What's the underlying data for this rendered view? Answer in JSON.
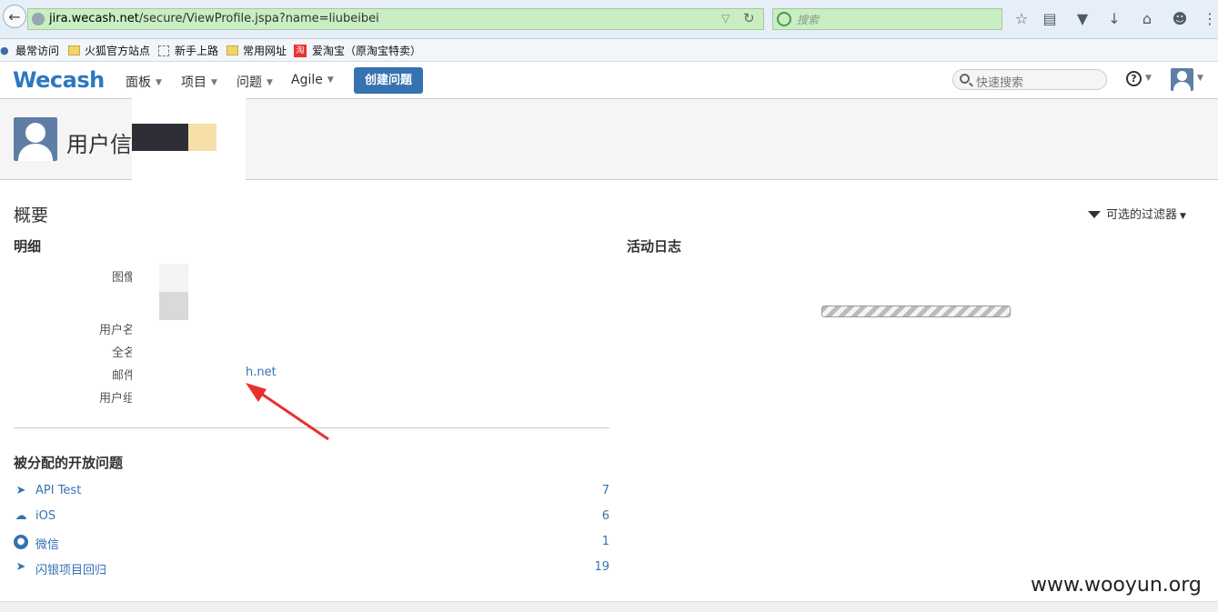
{
  "browser": {
    "url_host": "jira.wecash.net",
    "url_path": "/secure/ViewProfile.jspa?name=liubeibei",
    "search_placeholder": "搜索",
    "bookmarks": [
      "最常访问",
      "火狐官方站点",
      "新手上路",
      "常用网址",
      "爱淘宝（原淘宝特卖）"
    ]
  },
  "header": {
    "logo": "Wecash",
    "nav": [
      "面板",
      "项目",
      "问题",
      "Agile"
    ],
    "create_label": "创建问题",
    "quick_search_placeholder": "快速搜索",
    "help": "?"
  },
  "profile": {
    "title": "用户信"
  },
  "main": {
    "overview_title": "概要",
    "filter_label": "可选的过滤器",
    "details_title": "明细",
    "field_labels": [
      "图像",
      "用户名",
      "全名",
      "邮件",
      "用户组"
    ],
    "email_visible": "h.net",
    "activity_title": "活动日志",
    "assigned_title": "被分配的开放问题",
    "projects": [
      {
        "name": "API Test",
        "count": "7",
        "icon": "rocket-icon"
      },
      {
        "name": "iOS",
        "count": "6",
        "icon": "cloud-icon"
      },
      {
        "name": "微信",
        "count": "1",
        "icon": "wechat-icon"
      },
      {
        "name": "闪银项目回归",
        "count": "19",
        "icon": "rocket-icon"
      }
    ]
  },
  "watermark": "www.wooyun.org",
  "colors": {
    "brand": "#3572b0",
    "url_bar": "#c8eec2",
    "annotation_arrow": "#e8312f"
  }
}
